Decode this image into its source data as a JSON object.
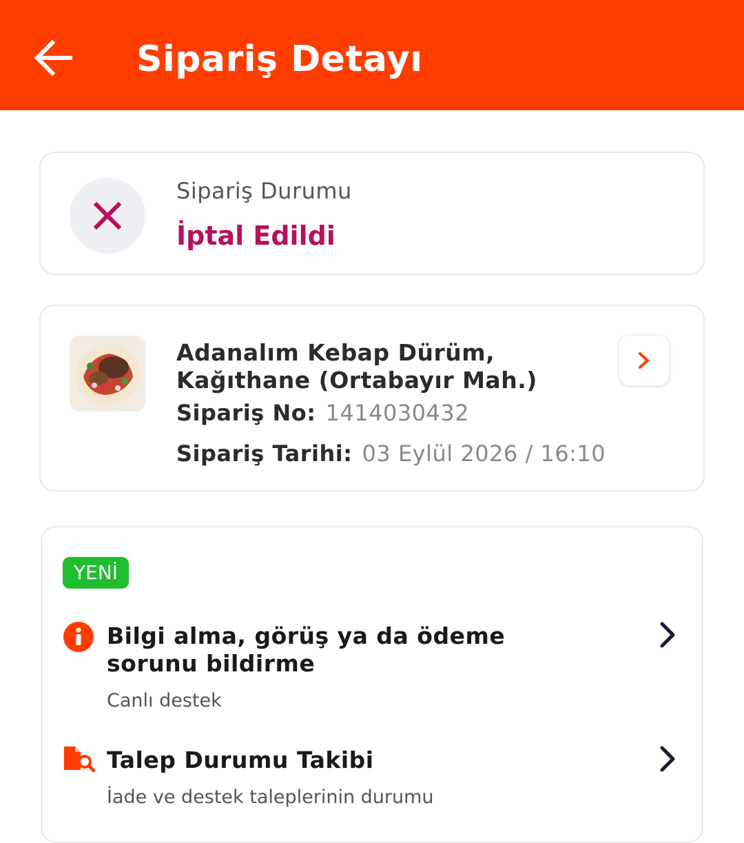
{
  "header": {
    "title": "Sipariş Detayı"
  },
  "status": {
    "label": "Sipariş Durumu",
    "value": "İptal Edildi"
  },
  "order": {
    "restaurant": "Adanalım Kebap Dürüm, Kağıthane (Ortabayır Mah.)",
    "order_no_label": "Sipariş No:",
    "order_no": "1414030432",
    "order_date_label": "Sipariş Tarihi:",
    "order_date": "03 Eylül 2026 / 16:10"
  },
  "help": {
    "badge": "YENİ",
    "items": [
      {
        "title": "Bilgi alma, görüş ya da ödeme sorunu bildirme",
        "subtitle": "Canlı destek",
        "icon": "info-icon"
      },
      {
        "title": "Talep Durumu Takibi",
        "subtitle": "İade ve destek taleplerinin durumu",
        "icon": "document-search-icon"
      }
    ]
  },
  "colors": {
    "brand": "#ff3d00",
    "cancelled": "#b5115f",
    "new_badge": "#1fbe2f"
  }
}
